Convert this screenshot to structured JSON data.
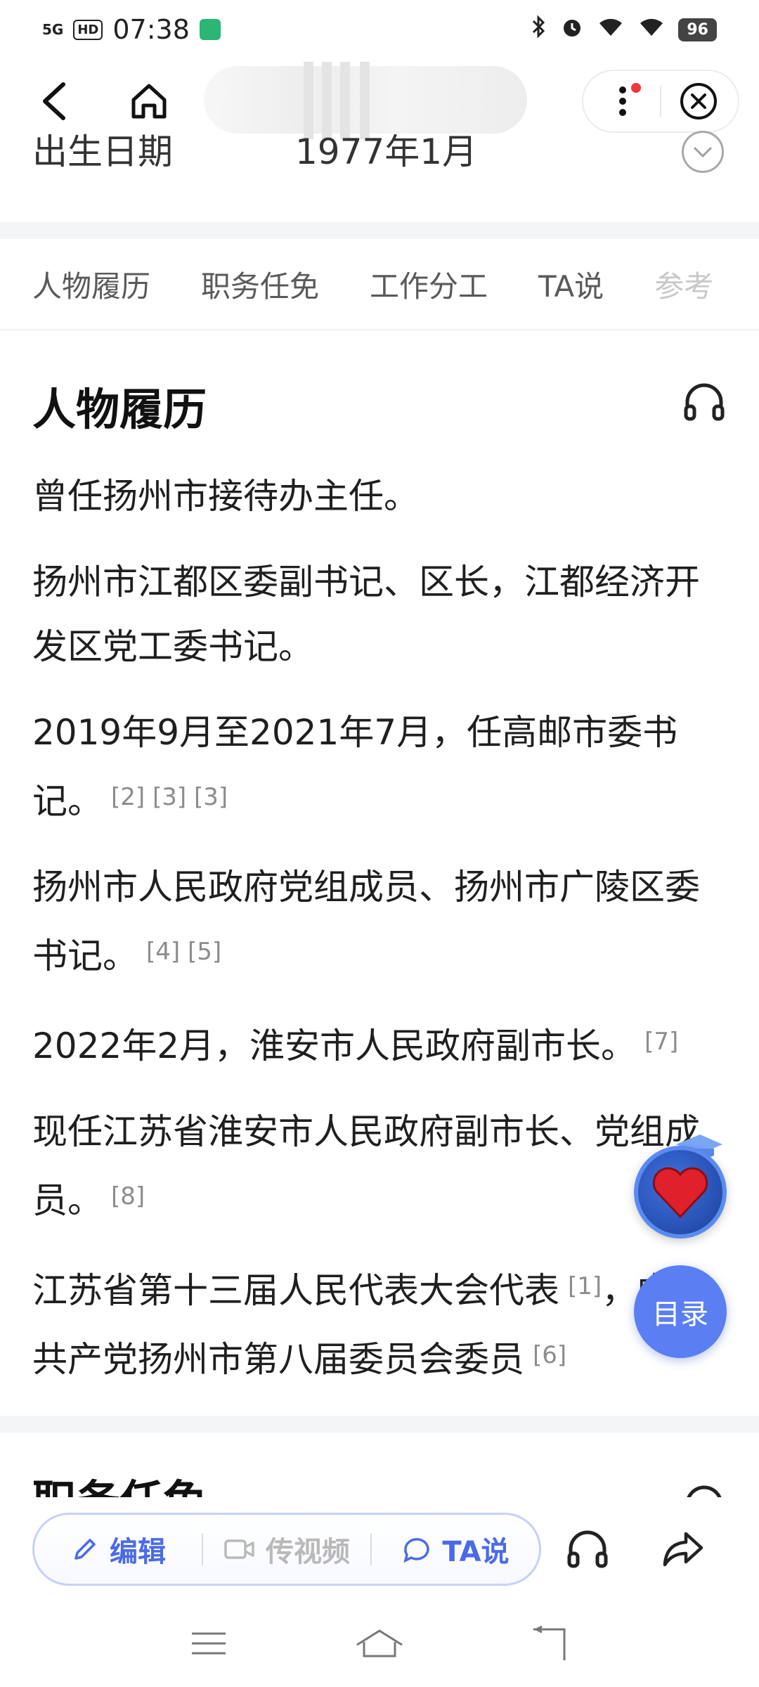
{
  "status_bar": {
    "network": "5G",
    "hd": "HD",
    "time": "07:38",
    "battery": "96"
  },
  "birth_row": {
    "label": "出生日期",
    "value": "1977年1月"
  },
  "tabs": [
    "人物履历",
    "职务任免",
    "工作分工",
    "TA说",
    "参考"
  ],
  "section": {
    "title": "人物履历",
    "paragraphs": [
      {
        "text": "曾任扬州市接待办主任。",
        "refs": ""
      },
      {
        "text": "扬州市江都区委副书记、区长，江都经济开发区党工委书记。",
        "refs": ""
      },
      {
        "text": "2019年9月至2021年7月，任高邮市委书记。",
        "refs": "[2] [3] [3]"
      },
      {
        "text": "扬州市人民政府党组成员、扬州市广陵区委书记。",
        "refs": "[4] [5]"
      },
      {
        "text": "2022年2月，淮安市人民政府副市长。",
        "refs": "[7]"
      },
      {
        "text": "现任江苏省淮安市人民政府副市长、党组成员。",
        "refs": "[8]"
      },
      {
        "text": "江苏省第十三届人民代表大会代表",
        "refs": "[1]",
        "text2": "，中国共产党扬州市第八届委员会委员",
        "refs2": "[6]"
      }
    ]
  },
  "floating": {
    "toc_label": "目录"
  },
  "next_section": {
    "title": "职务任免"
  },
  "toolbar": {
    "edit": "编辑",
    "video": "传视频",
    "ta": "TA说"
  }
}
